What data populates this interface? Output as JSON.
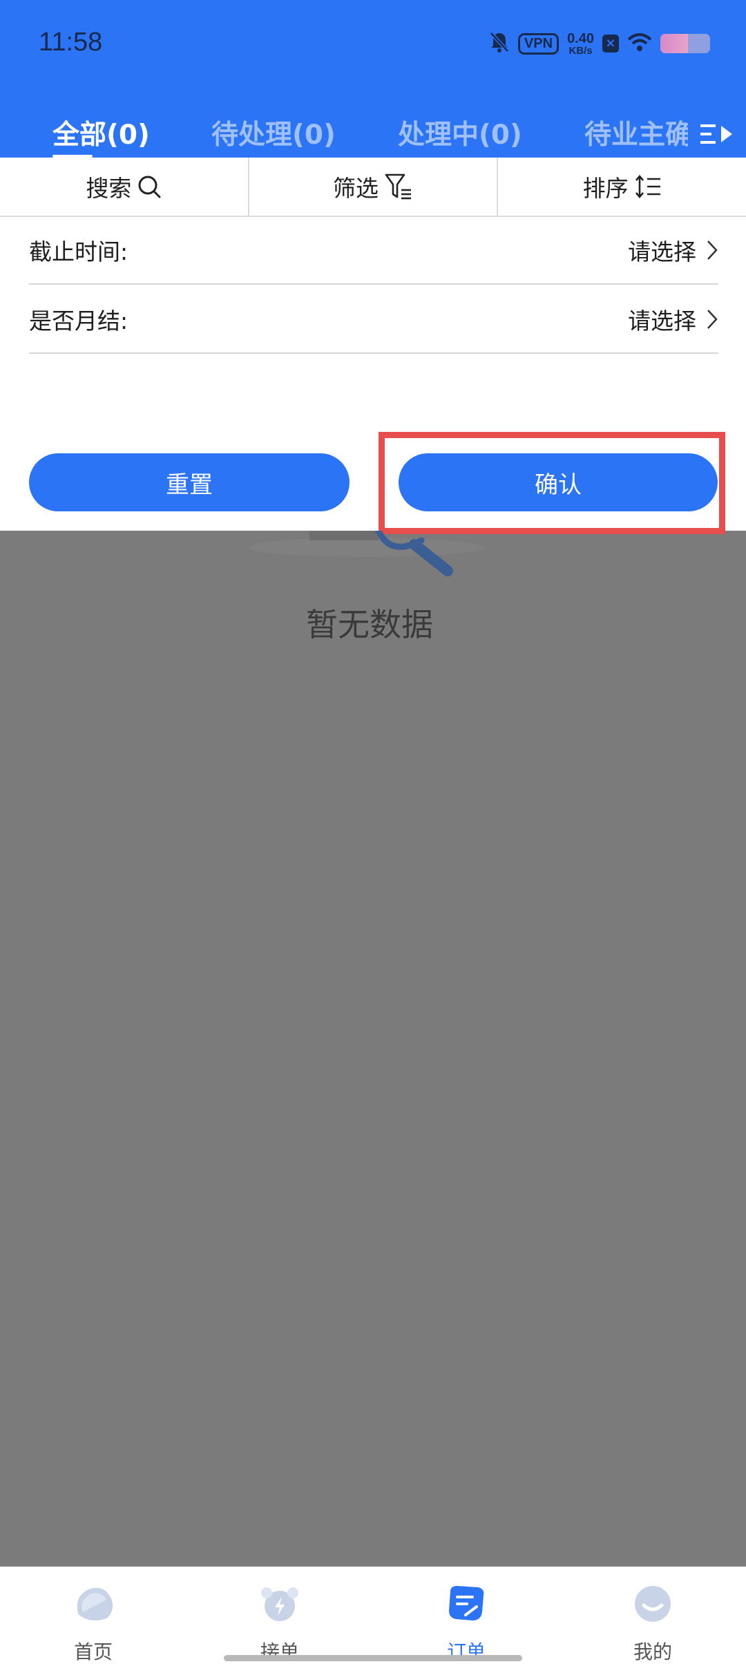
{
  "status_bar": {
    "time": "11:58",
    "vpn_label": "VPN",
    "net_speed_value": "0.40",
    "net_speed_unit": "KB/s",
    "x_badge": "×",
    "battery_level": 0.55,
    "icons": [
      "bell-off-icon",
      "wifi-icon",
      "battery-icon"
    ]
  },
  "tabs": [
    {
      "label": "全部(0)",
      "active": true
    },
    {
      "label": "待处理(0)",
      "active": false
    },
    {
      "label": "处理中(0)",
      "active": false
    },
    {
      "label": "待业主确",
      "active": false
    }
  ],
  "toolbar": {
    "search_label": "搜索",
    "filter_label": "筛选",
    "sort_label": "排序"
  },
  "filters": [
    {
      "label": "截止时间:",
      "value": "请选择"
    },
    {
      "label": "是否月结:",
      "value": "请选择"
    }
  ],
  "buttons": {
    "reset": "重置",
    "confirm": "确认"
  },
  "empty_state": {
    "text": "暂无数据"
  },
  "bottom_nav": [
    {
      "label": "首页",
      "icon": "home-icon",
      "active": false
    },
    {
      "label": "接单",
      "icon": "alarm-icon",
      "active": false
    },
    {
      "label": "订单",
      "icon": "order-icon",
      "active": true
    },
    {
      "label": "我的",
      "icon": "profile-icon",
      "active": false
    }
  ],
  "colors": {
    "primary": "#2b74f5",
    "highlight": "#e84e4e",
    "overlay": "#7b7b7b"
  }
}
